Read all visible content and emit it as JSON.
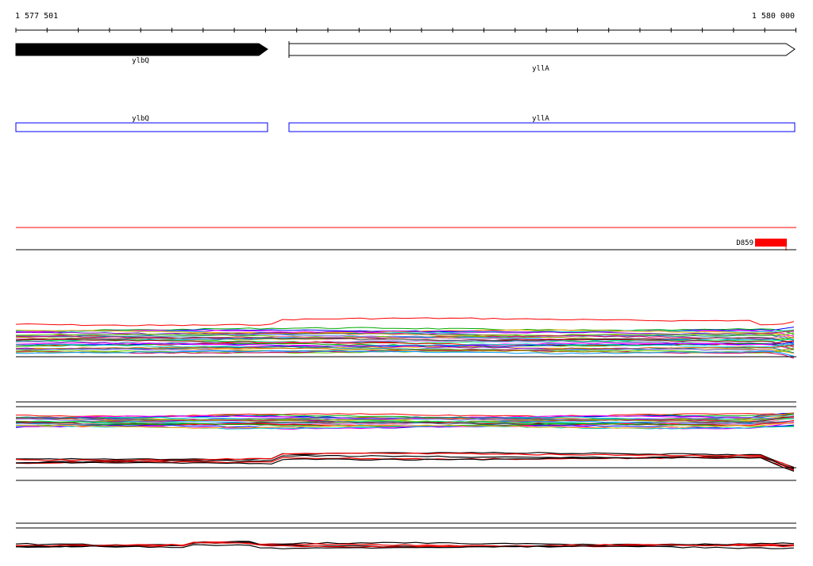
{
  "ruler": {
    "start_label": "1 577 501",
    "end_label": "1 580 000"
  },
  "genes": [
    {
      "name": "ylbQ",
      "strand": "+",
      "style": "filled"
    },
    {
      "name": "yllA",
      "strand": "+",
      "style": "outline"
    }
  ],
  "cds_track": [
    {
      "name": "ylbQ"
    },
    {
      "name": "yllA"
    }
  ],
  "feature": {
    "name": "D859",
    "color": "#ff0000"
  },
  "colors": {
    "cds_box": "#0000ff",
    "highlight_line": "#ff0000",
    "axis": "#000000",
    "feature": "#ff0000"
  }
}
